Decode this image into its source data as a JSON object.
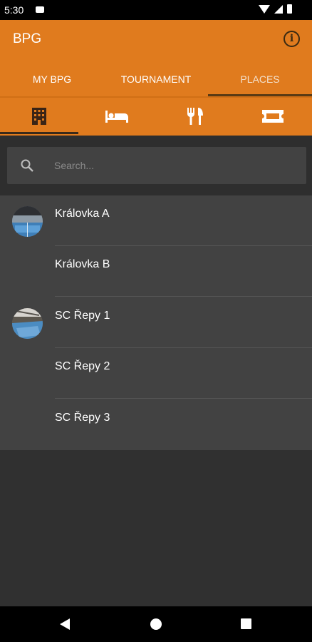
{
  "status_bar": {
    "time": "5:30"
  },
  "app_bar": {
    "title": "BPG",
    "info_icon": "info-icon",
    "background_color": "#e07b1e"
  },
  "tabs": [
    {
      "label": "MY BPG",
      "active": false
    },
    {
      "label": "TOURNAMENT",
      "active": false
    },
    {
      "label": "PLACES",
      "active": true
    }
  ],
  "subtabs": [
    {
      "icon": "building-icon",
      "active": true
    },
    {
      "icon": "hotel-bed-icon",
      "active": false
    },
    {
      "icon": "restaurant-icon",
      "active": false
    },
    {
      "icon": "ticket-icon",
      "active": false
    }
  ],
  "search": {
    "placeholder": "Search..."
  },
  "places": [
    {
      "name": "Královka A",
      "has_avatar": true
    },
    {
      "name": "Královka B",
      "has_avatar": false
    },
    {
      "name": "SC Řepy 1",
      "has_avatar": true
    },
    {
      "name": "SC Řepy 2",
      "has_avatar": false
    },
    {
      "name": "SC Řepy 3",
      "has_avatar": false
    }
  ]
}
